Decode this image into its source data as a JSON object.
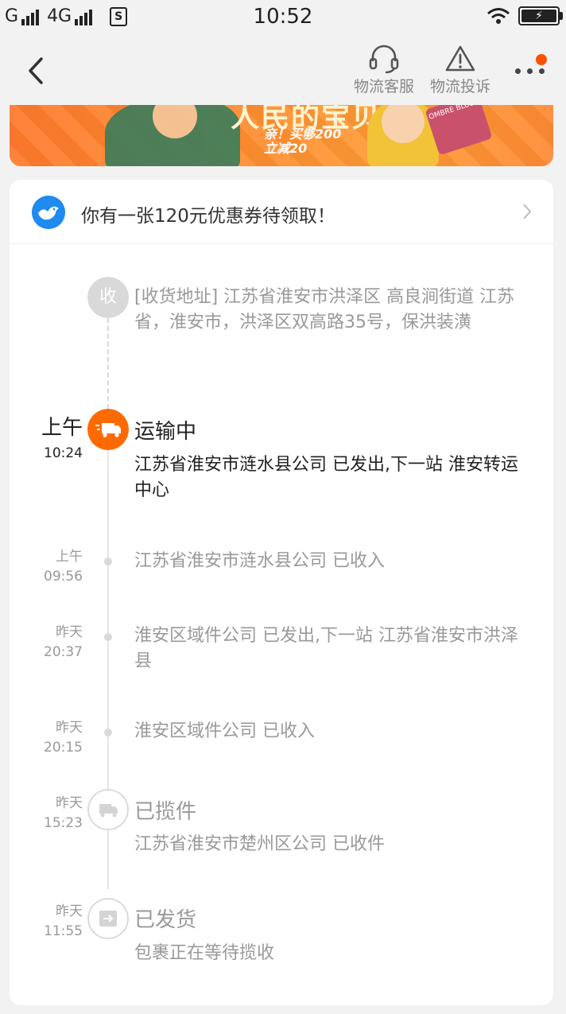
{
  "status_bar": {
    "carrier1": "G",
    "carrier2": "4G",
    "sim_icon": "S",
    "time": "10:52"
  },
  "nav": {
    "service_label": "物流客服",
    "complaint_label": "物流投诉"
  },
  "banner": {
    "headline": "人民的宝贝",
    "promo_line1": "亲！买够200",
    "promo_line2": "立减20",
    "phone_label": "OMBRE BLUSH"
  },
  "coupon": {
    "text": "你有一张120元优惠券待领取！"
  },
  "timeline": [
    {
      "node_label": "收",
      "desc": "[收货地址] 江苏省淮安市洪泽区 高良涧街道 江苏省，淮安市，洪泽区双高路35号，保洪装潢"
    },
    {
      "date_line1": "上午",
      "date_line2": "10:24",
      "title": "运输中",
      "desc": "江苏省淮安市涟水县公司 已发出,下一站 淮安转运中心"
    },
    {
      "date_line1": "上午",
      "date_line2": "09:56",
      "desc": "江苏省淮安市涟水县公司 已收入"
    },
    {
      "date_line1": "昨天",
      "date_line2": "20:37",
      "desc": "淮安区域件公司 已发出,下一站 江苏省淮安市洪泽县"
    },
    {
      "date_line1": "昨天",
      "date_line2": "20:15",
      "desc": "淮安区域件公司 已收入"
    },
    {
      "date_line1": "昨天",
      "date_line2": "15:23",
      "title": "已揽件",
      "desc": "江苏省淮安市楚州区公司 已收件"
    },
    {
      "date_line1": "昨天",
      "date_line2": "11:55",
      "title": "已发货",
      "desc": "包裹正在等待揽收"
    }
  ],
  "colors": {
    "accent": "#ff6a00",
    "node_grey": "#d9d9d9",
    "text_grey": "#999999"
  }
}
